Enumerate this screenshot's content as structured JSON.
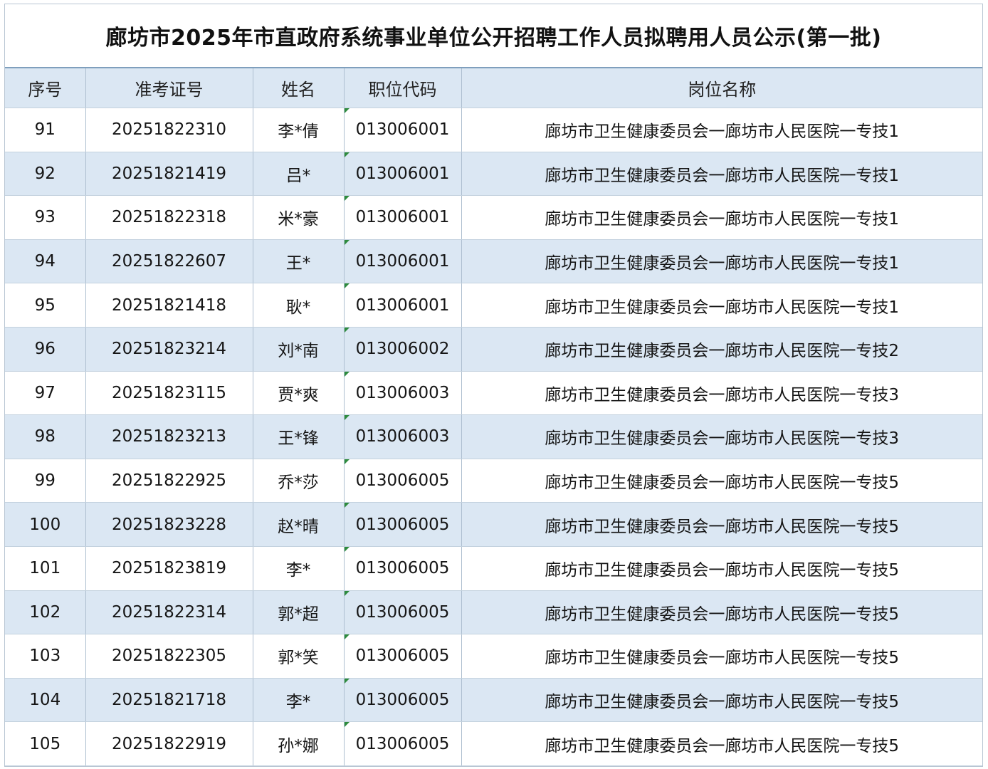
{
  "title": "廊坊市2025年市直政府系统事业单位公开招聘工作人员拟聘用人员公示(第一批)",
  "columns": [
    "序号",
    "准考证号",
    "姓名",
    "职位代码",
    "岗位名称"
  ],
  "rows": [
    {
      "no": "91",
      "exam_id": "20251822310",
      "name": "李*倩",
      "code": "013006001",
      "post": "廊坊市卫生健康委员会一廊坊市人民医院一专技1"
    },
    {
      "no": "92",
      "exam_id": "20251821419",
      "name": "吕*",
      "code": "013006001",
      "post": "廊坊市卫生健康委员会一廊坊市人民医院一专技1"
    },
    {
      "no": "93",
      "exam_id": "20251822318",
      "name": "米*豪",
      "code": "013006001",
      "post": "廊坊市卫生健康委员会一廊坊市人民医院一专技1"
    },
    {
      "no": "94",
      "exam_id": "20251822607",
      "name": "王*",
      "code": "013006001",
      "post": "廊坊市卫生健康委员会一廊坊市人民医院一专技1"
    },
    {
      "no": "95",
      "exam_id": "20251821418",
      "name": "耿*",
      "code": "013006001",
      "post": "廊坊市卫生健康委员会一廊坊市人民医院一专技1"
    },
    {
      "no": "96",
      "exam_id": "20251823214",
      "name": "刘*南",
      "code": "013006002",
      "post": "廊坊市卫生健康委员会一廊坊市人民医院一专技2"
    },
    {
      "no": "97",
      "exam_id": "20251823115",
      "name": "贾*爽",
      "code": "013006003",
      "post": "廊坊市卫生健康委员会一廊坊市人民医院一专技3"
    },
    {
      "no": "98",
      "exam_id": "20251823213",
      "name": "王*锋",
      "code": "013006003",
      "post": "廊坊市卫生健康委员会一廊坊市人民医院一专技3"
    },
    {
      "no": "99",
      "exam_id": "20251822925",
      "name": "乔*莎",
      "code": "013006005",
      "post": "廊坊市卫生健康委员会一廊坊市人民医院一专技5"
    },
    {
      "no": "100",
      "exam_id": "20251823228",
      "name": "赵*晴",
      "code": "013006005",
      "post": "廊坊市卫生健康委员会一廊坊市人民医院一专技5"
    },
    {
      "no": "101",
      "exam_id": "20251823819",
      "name": "李*",
      "code": "013006005",
      "post": "廊坊市卫生健康委员会一廊坊市人民医院一专技5"
    },
    {
      "no": "102",
      "exam_id": "20251822314",
      "name": "郭*超",
      "code": "013006005",
      "post": "廊坊市卫生健康委员会一廊坊市人民医院一专技5"
    },
    {
      "no": "103",
      "exam_id": "20251822305",
      "name": "郭*笑",
      "code": "013006005",
      "post": "廊坊市卫生健康委员会一廊坊市人民医院一专技5"
    },
    {
      "no": "104",
      "exam_id": "20251821718",
      "name": "李*",
      "code": "013006005",
      "post": "廊坊市卫生健康委员会一廊坊市人民医院一专技5"
    },
    {
      "no": "105",
      "exam_id": "20251822919",
      "name": "孙*娜",
      "code": "013006005",
      "post": "廊坊市卫生健康委员会一廊坊市人民医院一专技5"
    }
  ]
}
